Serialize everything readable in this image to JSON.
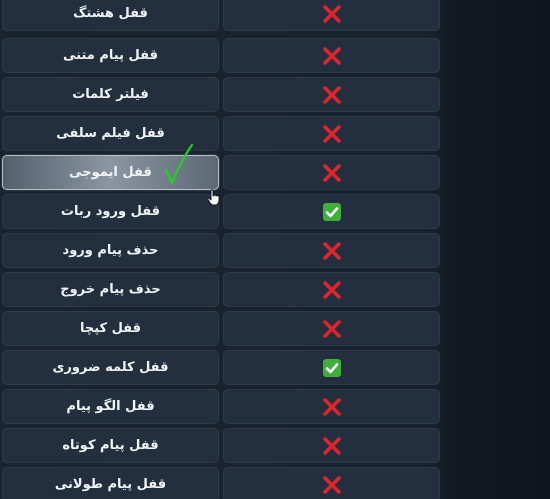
{
  "settings_list": {
    "rows": [
      {
        "label": "قفل هشتگ",
        "status": "disabled",
        "status_icon": "cross-icon",
        "active": false
      },
      {
        "label": "قفل پیام متنی",
        "status": "disabled",
        "status_icon": "cross-icon",
        "active": false
      },
      {
        "label": "فیلتر کلمات",
        "status": "disabled",
        "status_icon": "cross-icon",
        "active": false
      },
      {
        "label": "قفل فیلم سلفی",
        "status": "disabled",
        "status_icon": "cross-icon",
        "active": false
      },
      {
        "label": "قفل ایموجی",
        "status": "disabled",
        "status_icon": "cross-icon",
        "active": true
      },
      {
        "label": "قفل ورود ربات",
        "status": "enabled",
        "status_icon": "check-box-icon",
        "active": false
      },
      {
        "label": "حذف پیام ورود",
        "status": "disabled",
        "status_icon": "cross-icon",
        "active": false
      },
      {
        "label": "حذف پیام خروج",
        "status": "disabled",
        "status_icon": "cross-icon",
        "active": false
      },
      {
        "label": "قفل کپچا",
        "status": "disabled",
        "status_icon": "cross-icon",
        "active": false
      },
      {
        "label": "قفل کلمه ضروری",
        "status": "enabled",
        "status_icon": "check-box-icon",
        "active": false
      },
      {
        "label": "قفل الگو پیام",
        "status": "disabled",
        "status_icon": "cross-icon",
        "active": false
      },
      {
        "label": "قفل پیام کوتاه",
        "status": "disabled",
        "status_icon": "cross-icon",
        "active": false
      },
      {
        "label": "قفل پیام طولانی",
        "status": "disabled",
        "status_icon": "cross-icon",
        "active": false
      }
    ]
  },
  "colors": {
    "button_bg": "#232f3e",
    "cross": "#e0242b",
    "check_bg": "#3fae3a",
    "annotation_pen": "#1fd31f"
  },
  "annotation": {
    "icon": "handwritten-check-mark-icon"
  },
  "pointer": {
    "icon": "hand-pointer-icon"
  }
}
